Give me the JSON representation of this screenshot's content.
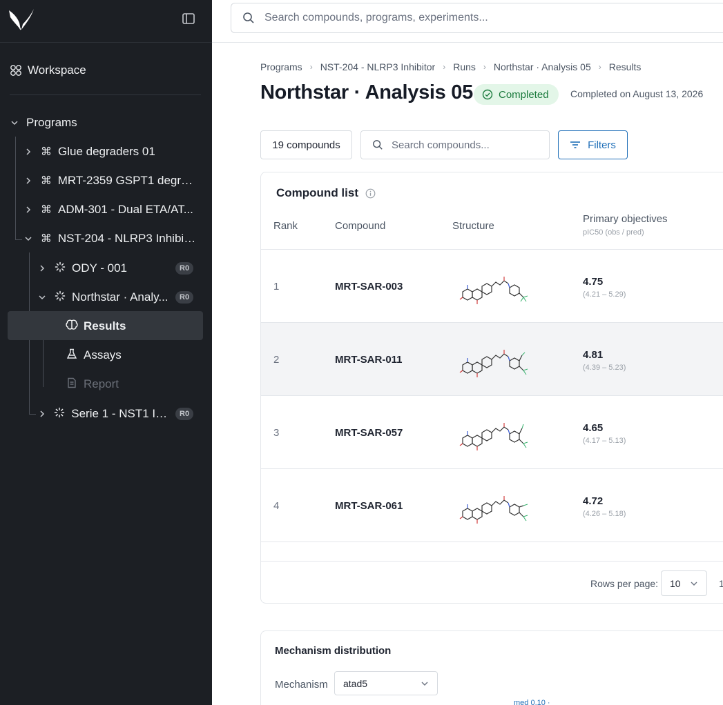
{
  "sidebar": {
    "workspace_label": "Workspace",
    "programs_label": "Programs",
    "items": [
      {
        "label": "Glue degraders 01"
      },
      {
        "label": "MRT-2359 GSPT1 degra..."
      },
      {
        "label": "ADM-301 - Dual ETA/AT..."
      },
      {
        "label": "NST-204 - NLRP3 Inhibit..."
      }
    ],
    "runs": [
      {
        "label": "ODY - 001",
        "badge": "R0"
      },
      {
        "label": "Northstar · Analy...",
        "badge": "R0"
      },
      {
        "label": "Serie 1 - NST1 Ini...",
        "badge": "R0"
      }
    ],
    "sub_items": [
      {
        "label": "Results"
      },
      {
        "label": "Assays"
      },
      {
        "label": "Report"
      }
    ]
  },
  "search": {
    "placeholder": "Search compounds, programs, experiments..."
  },
  "breadcrumb": [
    "Programs",
    "NST-204 - NLRP3 Inhibitor",
    "Runs",
    "Northstar · Analysis 05",
    "Results"
  ],
  "page": {
    "title": "Northstar · Analysis 05",
    "status": "Completed",
    "completed_on": "Completed on August 13, 2026"
  },
  "toolbar": {
    "count_label": "19 compounds",
    "search_placeholder": "Search compounds...",
    "filters_label": "Filters"
  },
  "compound_list": {
    "title": "Compound list",
    "columns": {
      "rank": "Rank",
      "compound": "Compound",
      "structure": "Structure",
      "objectives": "Primary objectives",
      "objectives_sub": "pIC50 (obs / pred)"
    },
    "rows": [
      {
        "rank": "1",
        "compound": "MRT-SAR-003",
        "value": "4.75",
        "range": "(4.21 – 5.29)"
      },
      {
        "rank": "2",
        "compound": "MRT-SAR-011",
        "value": "4.81",
        "range": "(4.39 – 5.23)"
      },
      {
        "rank": "3",
        "compound": "MRT-SAR-057",
        "value": "4.65",
        "range": "(4.17 – 5.13)"
      },
      {
        "rank": "4",
        "compound": "MRT-SAR-061",
        "value": "4.72",
        "range": "(4.26 – 5.18)"
      }
    ],
    "rows_per_page_label": "Rows per page:",
    "rows_per_page": "10",
    "page_number": "1"
  },
  "mechanism": {
    "title": "Mechanism distribution",
    "label": "Mechanism",
    "selected": "atad5",
    "med_label": "med 0.10 ·"
  },
  "colors": {
    "sidebar_bg": "#1c1f24",
    "accent": "#1f6fb8",
    "status_green": "#1a7a3c",
    "status_green_bg": "#e3f6e8"
  },
  "icons": {
    "logo": "brand-logo-icon",
    "collapse": "sidebar-toggle-icon",
    "workspace": "workspace-icon",
    "program": "command-icon",
    "run": "loader-icon",
    "results": "brain-icon",
    "assays": "flask-icon",
    "report": "document-icon",
    "search": "search-icon",
    "filter": "filter-icon",
    "info": "info-icon",
    "check": "check-circle-icon"
  }
}
